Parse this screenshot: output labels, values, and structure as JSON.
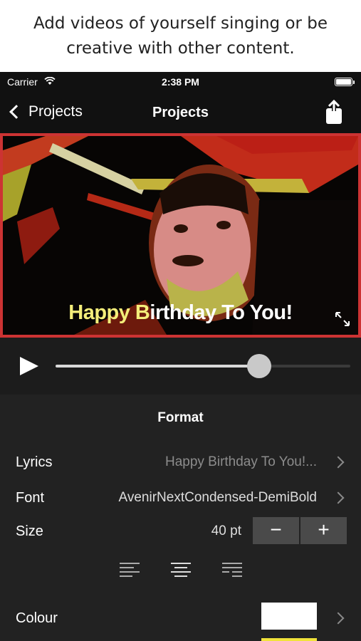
{
  "caption": {
    "line1": "Add videos of yourself singing or be",
    "line2": "creative with other content."
  },
  "status_bar": {
    "carrier": "Carrier",
    "time": "2:38 PM"
  },
  "nav": {
    "back_label": "Projects",
    "title": "Projects"
  },
  "video": {
    "overlay_text": "Happy Birthday To You!"
  },
  "player": {
    "progress": 0.69
  },
  "format": {
    "title": "Format",
    "lyrics": {
      "label": "Lyrics",
      "value": "Happy Birthday To You!..."
    },
    "font": {
      "label": "Font",
      "value": "AvenirNextCondensed-DemiBold"
    },
    "size": {
      "label": "Size",
      "value": "40 pt",
      "minus": "−",
      "plus": "+"
    },
    "colour": {
      "label": "Colour",
      "swatch_color": "#ffffff",
      "next_swatch_color": "#f1e33a"
    }
  },
  "colors": {
    "preview_border": "#cc3333"
  }
}
